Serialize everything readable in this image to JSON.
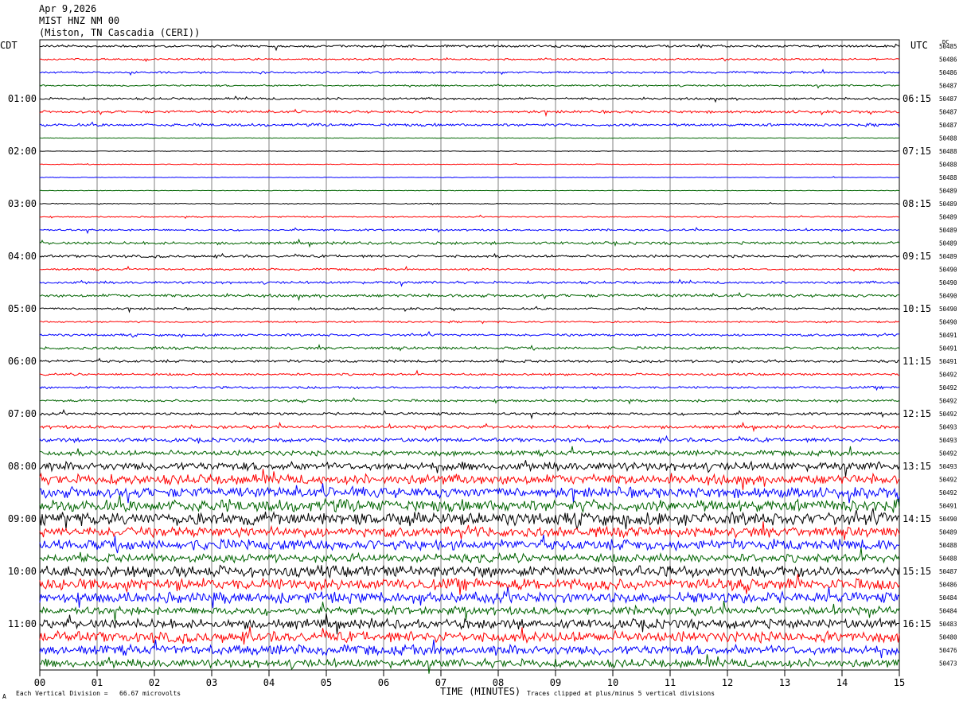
{
  "header": {
    "date": "Apr 9,2026",
    "station": "MIST HNZ NM 00",
    "location": "(Miston, TN Cascadia (CERI))"
  },
  "left_axis_label": "CDT",
  "right_axis_label": "UTC",
  "dc_label": "DC",
  "footer": {
    "scale_note": "Each Vertical Division =   66.67 microvolts",
    "clip_note": "Traces clipped at plus/minus 5 vertical divisions",
    "corner_mark": "A"
  },
  "colors": {
    "trace_cycle": [
      "#000000",
      "#ff0000",
      "#0000ff",
      "#006400"
    ],
    "grid": "#808080"
  },
  "chart_data": {
    "type": "line",
    "title": "",
    "xlabel": "TIME (MINUTES)",
    "ylabel": "",
    "xlim": [
      0,
      15
    ],
    "x_ticks": [
      "00",
      "01",
      "02",
      "03",
      "04",
      "05",
      "06",
      "07",
      "08",
      "09",
      "10",
      "11",
      "12",
      "13",
      "14",
      "15"
    ],
    "row_minutes": 15,
    "left_time_labels": [
      {
        "row": 4,
        "label": "01:00"
      },
      {
        "row": 8,
        "label": "02:00"
      },
      {
        "row": 12,
        "label": "03:00"
      },
      {
        "row": 16,
        "label": "04:00"
      },
      {
        "row": 20,
        "label": "05:00"
      },
      {
        "row": 24,
        "label": "06:00"
      },
      {
        "row": 28,
        "label": "07:00"
      },
      {
        "row": 32,
        "label": "08:00"
      },
      {
        "row": 36,
        "label": "09:00"
      },
      {
        "row": 40,
        "label": "10:00"
      },
      {
        "row": 44,
        "label": "11:00"
      }
    ],
    "right_time_labels": [
      {
        "row": 4,
        "label": "06:15"
      },
      {
        "row": 8,
        "label": "07:15"
      },
      {
        "row": 12,
        "label": "08:15"
      },
      {
        "row": 16,
        "label": "09:15"
      },
      {
        "row": 20,
        "label": "10:15"
      },
      {
        "row": 24,
        "label": "11:15"
      },
      {
        "row": 28,
        "label": "12:15"
      },
      {
        "row": 32,
        "label": "13:15"
      },
      {
        "row": 36,
        "label": "14:15"
      },
      {
        "row": 40,
        "label": "15:15"
      },
      {
        "row": 44,
        "label": "16:15"
      }
    ],
    "dc_offsets": [
      "50485",
      "50486",
      "50486",
      "50487",
      "50487",
      "50487",
      "50487",
      "50488",
      "50488",
      "50488",
      "50488",
      "50489",
      "50489",
      "50489",
      "50489",
      "50489",
      "50489",
      "50490",
      "50490",
      "50490",
      "50490",
      "50490",
      "50491",
      "50491",
      "50491",
      "50492",
      "50492",
      "50492",
      "50492",
      "50493",
      "50493",
      "50492",
      "50493",
      "50492",
      "50492",
      "50491",
      "50490",
      "50489",
      "50488",
      "50488",
      "50487",
      "50486",
      "50484",
      "50484",
      "50483",
      "50480",
      "50476",
      "50473"
    ],
    "trace_activity": [
      1.2,
      0.9,
      1.0,
      0.9,
      1.1,
      1.3,
      1.4,
      0.3,
      0.3,
      0.4,
      0.3,
      0.3,
      0.5,
      0.6,
      0.9,
      1.4,
      1.3,
      1.0,
      1.3,
      1.5,
      1.1,
      0.9,
      1.2,
      1.4,
      1.3,
      1.1,
      1.2,
      1.2,
      1.3,
      1.6,
      2.0,
      2.6,
      4.2,
      5.0,
      5.2,
      6.0,
      6.4,
      5.0,
      5.4,
      4.2,
      5.6,
      5.8,
      5.5,
      4.0,
      4.8,
      5.4,
      5.0,
      4.2
    ]
  }
}
